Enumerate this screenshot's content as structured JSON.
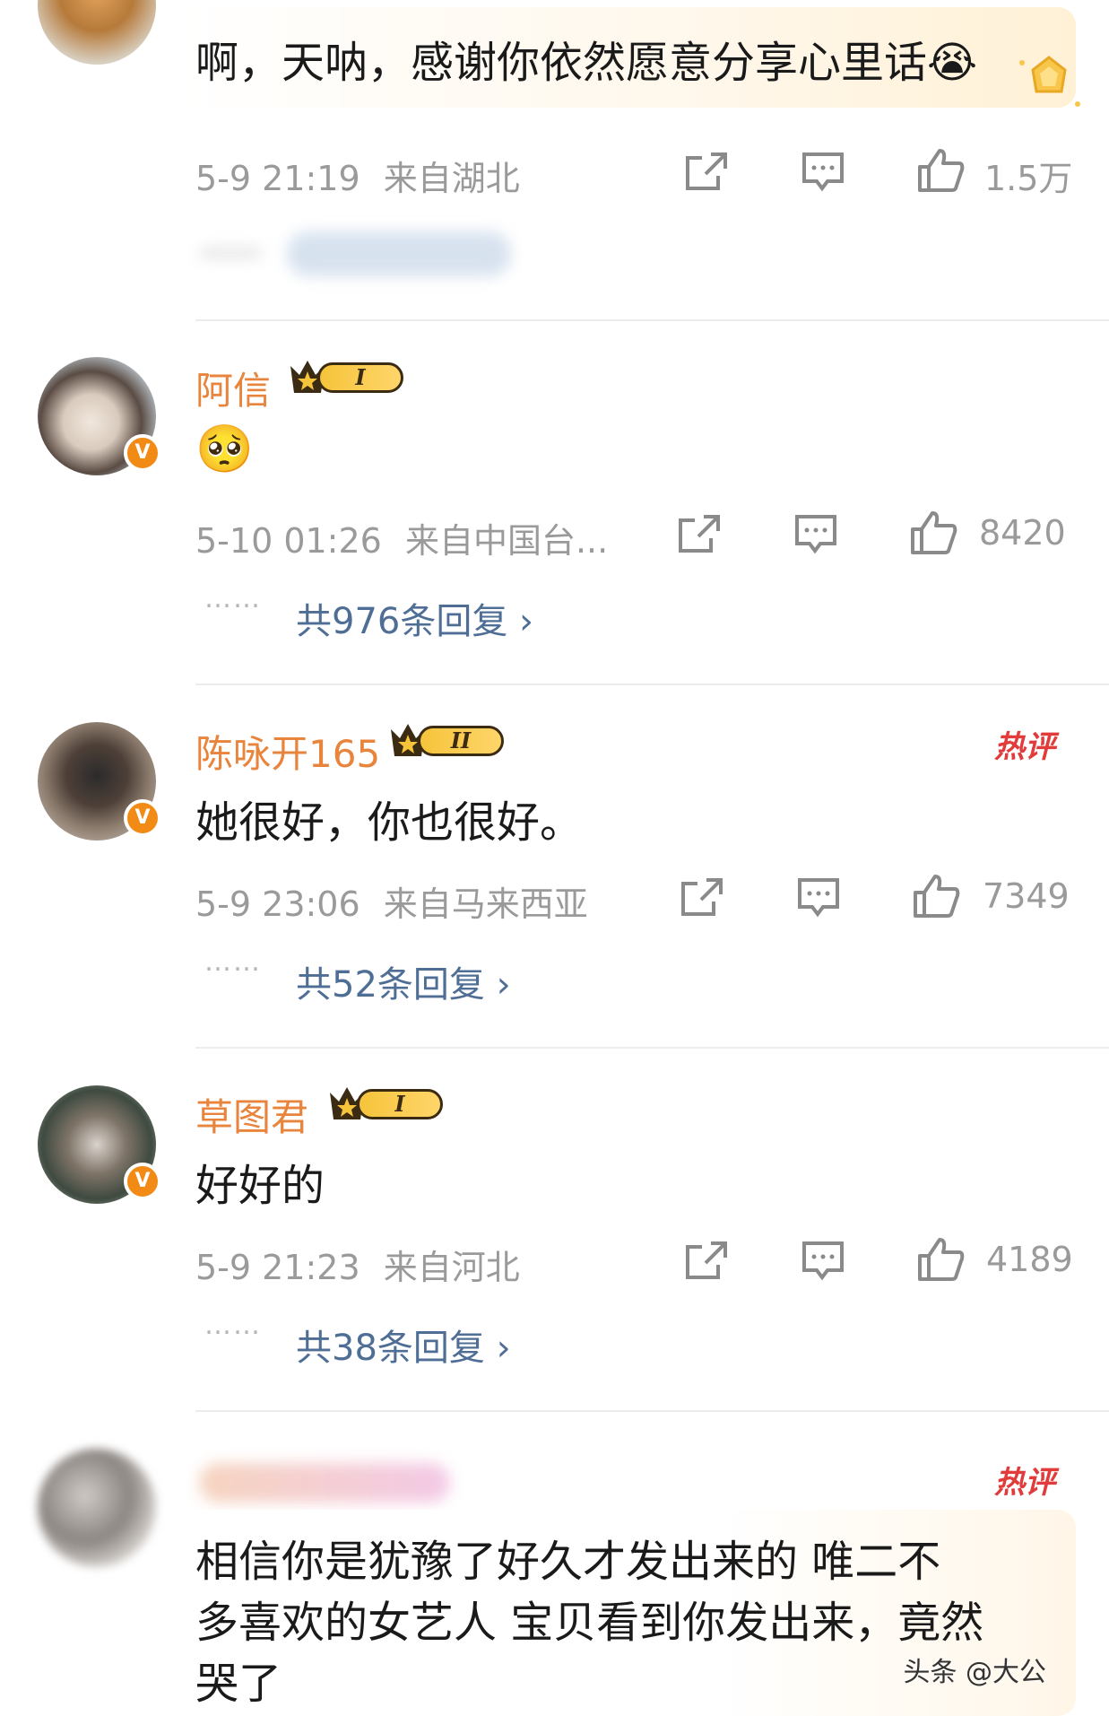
{
  "comments": [
    {
      "content": "啊，天呐，感谢你依然愿意分享心里话😭",
      "time": "5-9 21:19",
      "location": "来自湖北",
      "likes": "1.5万"
    },
    {
      "username": "阿信",
      "level": "I",
      "content": "🥺",
      "time": "5-10 01:26",
      "location": "来自中国台...",
      "likes": "8420",
      "replies": "共976条回复 ›"
    },
    {
      "username": "陈咏开165",
      "level": "II",
      "hot_tag": "热评",
      "content": "她很好，你也很好。",
      "time": "5-9 23:06",
      "location": "来自马来西亚",
      "likes": "7349",
      "replies": "共52条回复 ›"
    },
    {
      "username": "草图君",
      "level": "I",
      "content": "好好的",
      "time": "5-9 21:23",
      "location": "来自河北",
      "likes": "4189",
      "replies": "共38条回复 ›"
    },
    {
      "hot_tag": "热评",
      "content_line1": "相信你是犹豫了好久才发出来的 唯二不",
      "content_line2": "多喜欢的女艺人 宝贝看到你发出来，竟然",
      "content_line3": "哭了"
    }
  ],
  "watermark": "头条 @大公",
  "reply_dots": "……",
  "colors": {
    "username": "#e8843c",
    "reply_link": "#4f6e96",
    "meta": "#9a9a9a",
    "hot": "#e23b3b"
  },
  "icons": [
    "share-icon",
    "comment-icon",
    "like-icon",
    "verified-icon",
    "crown-icon"
  ]
}
